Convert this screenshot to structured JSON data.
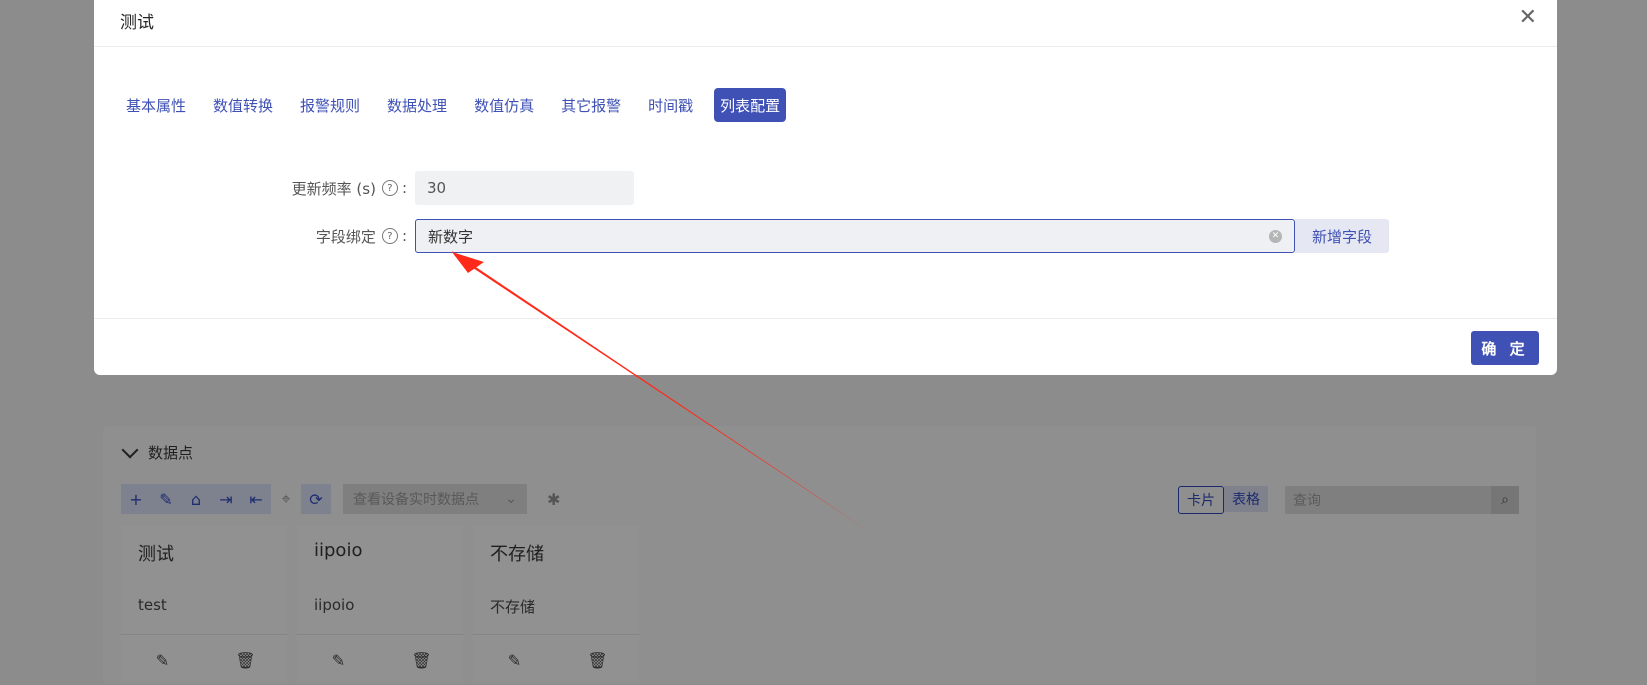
{
  "modal": {
    "title": "测试",
    "tabs": [
      {
        "label": "基本属性"
      },
      {
        "label": "数值转换"
      },
      {
        "label": "报警规则"
      },
      {
        "label": "数据处理"
      },
      {
        "label": "数值仿真"
      },
      {
        "label": "其它报警"
      },
      {
        "label": "时间戳"
      },
      {
        "label": "列表配置",
        "active": true
      }
    ],
    "form": {
      "update_freq_label": "更新频率 (s)",
      "update_freq_value": "30",
      "field_bind_label": "字段绑定",
      "field_bind_value": "新数字",
      "add_field_button": "新增字段"
    },
    "ok_button": "确 定"
  },
  "background": {
    "section_title": "数据点",
    "realtime_select": "查看设备实时数据点",
    "view_toggle": [
      "卡片",
      "表格"
    ],
    "search_placeholder": "查询",
    "cards": [
      {
        "title": "测试",
        "subtitle": "test"
      },
      {
        "title": "iipoio",
        "subtitle": "iipoio"
      },
      {
        "title": "不存储",
        "subtitle": "不存储"
      }
    ]
  },
  "colors": {
    "accent": "#3f51b5",
    "annotation_arrow": "#ff2a1a"
  }
}
